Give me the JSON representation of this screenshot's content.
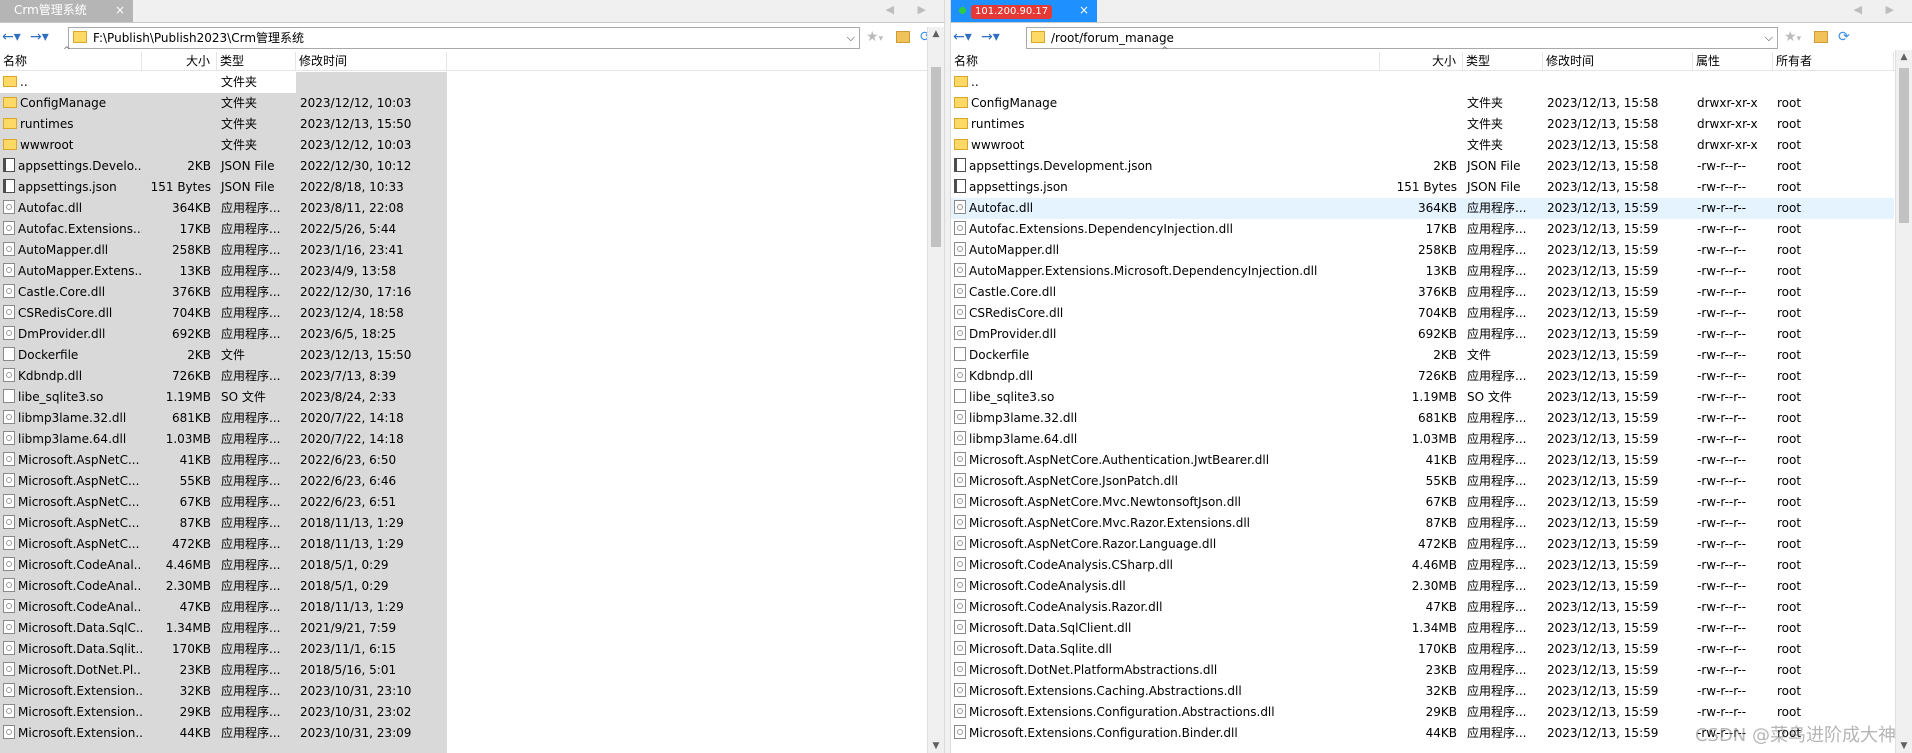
{
  "left": {
    "tab_title": "Crm管理系统",
    "tab_close": "×",
    "tab_arrows": "◀ ▶",
    "nav_back": "←▾",
    "nav_forward": "→▾",
    "address": "F:\\Publish\\Publish2023\\Crm管理系统",
    "address_drop": "⌵",
    "headers": {
      "name": "名称",
      "size": "大小",
      "type": "类型",
      "modified": "修改时间"
    },
    "sort_caret": "^",
    "rows": [
      {
        "icon": "folder",
        "name": "..",
        "size": "",
        "type": "文件夹",
        "modified": ""
      },
      {
        "icon": "folder",
        "name": "ConfigManage",
        "size": "",
        "type": "文件夹",
        "modified": "2023/12/12, 10:03"
      },
      {
        "icon": "folder",
        "name": "runtimes",
        "size": "",
        "type": "文件夹",
        "modified": "2023/12/13, 15:50"
      },
      {
        "icon": "folder",
        "name": "wwwroot",
        "size": "",
        "type": "文件夹",
        "modified": "2023/12/12, 10:03"
      },
      {
        "icon": "json",
        "name": "appsettings.Develo...",
        "size": "2KB",
        "type": "JSON File",
        "modified": "2022/12/30, 10:12"
      },
      {
        "icon": "json",
        "name": "appsettings.json",
        "size": "151 Bytes",
        "type": "JSON File",
        "modified": "2022/8/18, 10:33"
      },
      {
        "icon": "dll",
        "name": "Autofac.dll",
        "size": "364KB",
        "type": "应用程序...",
        "modified": "2023/8/11, 22:08"
      },
      {
        "icon": "dll",
        "name": "Autofac.Extensions....",
        "size": "17KB",
        "type": "应用程序...",
        "modified": "2022/5/26, 5:44"
      },
      {
        "icon": "dll",
        "name": "AutoMapper.dll",
        "size": "258KB",
        "type": "应用程序...",
        "modified": "2023/1/16, 23:41"
      },
      {
        "icon": "dll",
        "name": "AutoMapper.Extens...",
        "size": "13KB",
        "type": "应用程序...",
        "modified": "2023/4/9, 13:58"
      },
      {
        "icon": "dll",
        "name": "Castle.Core.dll",
        "size": "376KB",
        "type": "应用程序...",
        "modified": "2022/12/30, 17:16"
      },
      {
        "icon": "dll",
        "name": "CSRedisCore.dll",
        "size": "704KB",
        "type": "应用程序...",
        "modified": "2023/12/4, 18:58"
      },
      {
        "icon": "dll",
        "name": "DmProvider.dll",
        "size": "692KB",
        "type": "应用程序...",
        "modified": "2023/6/5, 18:25"
      },
      {
        "icon": "file",
        "name": "Dockerfile",
        "size": "2KB",
        "type": "文件",
        "modified": "2023/12/13, 15:50"
      },
      {
        "icon": "dll",
        "name": "Kdbndp.dll",
        "size": "726KB",
        "type": "应用程序...",
        "modified": "2023/7/13, 8:39"
      },
      {
        "icon": "file",
        "name": "libe_sqlite3.so",
        "size": "1.19MB",
        "type": "SO 文件",
        "modified": "2023/8/24, 2:33"
      },
      {
        "icon": "dll",
        "name": "libmp3lame.32.dll",
        "size": "681KB",
        "type": "应用程序...",
        "modified": "2020/7/22, 14:18"
      },
      {
        "icon": "dll",
        "name": "libmp3lame.64.dll",
        "size": "1.03MB",
        "type": "应用程序...",
        "modified": "2020/7/22, 14:18"
      },
      {
        "icon": "dll",
        "name": "Microsoft.AspNetC...",
        "size": "41KB",
        "type": "应用程序...",
        "modified": "2022/6/23, 6:50"
      },
      {
        "icon": "dll",
        "name": "Microsoft.AspNetC...",
        "size": "55KB",
        "type": "应用程序...",
        "modified": "2022/6/23, 6:46"
      },
      {
        "icon": "dll",
        "name": "Microsoft.AspNetC...",
        "size": "67KB",
        "type": "应用程序...",
        "modified": "2022/6/23, 6:51"
      },
      {
        "icon": "dll",
        "name": "Microsoft.AspNetC...",
        "size": "87KB",
        "type": "应用程序...",
        "modified": "2018/11/13, 1:29"
      },
      {
        "icon": "dll",
        "name": "Microsoft.AspNetC...",
        "size": "472KB",
        "type": "应用程序...",
        "modified": "2018/11/13, 1:29"
      },
      {
        "icon": "dll",
        "name": "Microsoft.CodeAnal...",
        "size": "4.46MB",
        "type": "应用程序...",
        "modified": "2018/5/1, 0:29"
      },
      {
        "icon": "dll",
        "name": "Microsoft.CodeAnal...",
        "size": "2.30MB",
        "type": "应用程序...",
        "modified": "2018/5/1, 0:29"
      },
      {
        "icon": "dll",
        "name": "Microsoft.CodeAnal...",
        "size": "47KB",
        "type": "应用程序...",
        "modified": "2018/11/13, 1:29"
      },
      {
        "icon": "dll",
        "name": "Microsoft.Data.SqlC...",
        "size": "1.34MB",
        "type": "应用程序...",
        "modified": "2021/9/21, 7:59"
      },
      {
        "icon": "dll",
        "name": "Microsoft.Data.Sqlit...",
        "size": "170KB",
        "type": "应用程序...",
        "modified": "2023/11/1, 6:15"
      },
      {
        "icon": "dll",
        "name": "Microsoft.DotNet.Pl...",
        "size": "23KB",
        "type": "应用程序...",
        "modified": "2018/5/16, 5:01"
      },
      {
        "icon": "dll",
        "name": "Microsoft.Extension...",
        "size": "32KB",
        "type": "应用程序...",
        "modified": "2023/10/31, 23:10"
      },
      {
        "icon": "dll",
        "name": "Microsoft.Extension...",
        "size": "29KB",
        "type": "应用程序...",
        "modified": "2023/10/31, 23:02"
      },
      {
        "icon": "dll",
        "name": "Microsoft.Extension...",
        "size": "44KB",
        "type": "应用程序...",
        "modified": "2023/10/31, 23:09"
      }
    ]
  },
  "right": {
    "tab_host": "101.200.90.17",
    "tab_close": "×",
    "tab_arrows": "◀ ▶",
    "nav_back": "←▾",
    "nav_forward": "→▾",
    "address": "/root/forum_manage",
    "address_drop": "⌵",
    "headers": {
      "name": "名称",
      "size": "大小",
      "type": "类型",
      "modified": "修改时间",
      "attr": "属性",
      "owner": "所有者"
    },
    "sort_caret": "^",
    "rows": [
      {
        "icon": "folder",
        "name": "..",
        "size": "",
        "type": "",
        "modified": "",
        "attr": "",
        "owner": ""
      },
      {
        "icon": "folder",
        "name": "ConfigManage",
        "size": "",
        "type": "文件夹",
        "modified": "2023/12/13, 15:58",
        "attr": "drwxr-xr-x",
        "owner": "root"
      },
      {
        "icon": "folder",
        "name": "runtimes",
        "size": "",
        "type": "文件夹",
        "modified": "2023/12/13, 15:58",
        "attr": "drwxr-xr-x",
        "owner": "root"
      },
      {
        "icon": "folder",
        "name": "wwwroot",
        "size": "",
        "type": "文件夹",
        "modified": "2023/12/13, 15:58",
        "attr": "drwxr-xr-x",
        "owner": "root"
      },
      {
        "icon": "json",
        "name": "appsettings.Development.json",
        "size": "2KB",
        "type": "JSON File",
        "modified": "2023/12/13, 15:58",
        "attr": "-rw-r--r--",
        "owner": "root"
      },
      {
        "icon": "json",
        "name": "appsettings.json",
        "size": "151 Bytes",
        "type": "JSON File",
        "modified": "2023/12/13, 15:58",
        "attr": "-rw-r--r--",
        "owner": "root"
      },
      {
        "icon": "dll",
        "name": "Autofac.dll",
        "size": "364KB",
        "type": "应用程序...",
        "modified": "2023/12/13, 15:59",
        "attr": "-rw-r--r--",
        "owner": "root",
        "selected": true
      },
      {
        "icon": "dll",
        "name": "Autofac.Extensions.DependencyInjection.dll",
        "size": "17KB",
        "type": "应用程序...",
        "modified": "2023/12/13, 15:59",
        "attr": "-rw-r--r--",
        "owner": "root"
      },
      {
        "icon": "dll",
        "name": "AutoMapper.dll",
        "size": "258KB",
        "type": "应用程序...",
        "modified": "2023/12/13, 15:59",
        "attr": "-rw-r--r--",
        "owner": "root"
      },
      {
        "icon": "dll",
        "name": "AutoMapper.Extensions.Microsoft.DependencyInjection.dll",
        "size": "13KB",
        "type": "应用程序...",
        "modified": "2023/12/13, 15:59",
        "attr": "-rw-r--r--",
        "owner": "root"
      },
      {
        "icon": "dll",
        "name": "Castle.Core.dll",
        "size": "376KB",
        "type": "应用程序...",
        "modified": "2023/12/13, 15:59",
        "attr": "-rw-r--r--",
        "owner": "root"
      },
      {
        "icon": "dll",
        "name": "CSRedisCore.dll",
        "size": "704KB",
        "type": "应用程序...",
        "modified": "2023/12/13, 15:59",
        "attr": "-rw-r--r--",
        "owner": "root"
      },
      {
        "icon": "dll",
        "name": "DmProvider.dll",
        "size": "692KB",
        "type": "应用程序...",
        "modified": "2023/12/13, 15:59",
        "attr": "-rw-r--r--",
        "owner": "root"
      },
      {
        "icon": "file",
        "name": "Dockerfile",
        "size": "2KB",
        "type": "文件",
        "modified": "2023/12/13, 15:59",
        "attr": "-rw-r--r--",
        "owner": "root"
      },
      {
        "icon": "dll",
        "name": "Kdbndp.dll",
        "size": "726KB",
        "type": "应用程序...",
        "modified": "2023/12/13, 15:59",
        "attr": "-rw-r--r--",
        "owner": "root"
      },
      {
        "icon": "file",
        "name": "libe_sqlite3.so",
        "size": "1.19MB",
        "type": "SO 文件",
        "modified": "2023/12/13, 15:59",
        "attr": "-rw-r--r--",
        "owner": "root"
      },
      {
        "icon": "dll",
        "name": "libmp3lame.32.dll",
        "size": "681KB",
        "type": "应用程序...",
        "modified": "2023/12/13, 15:59",
        "attr": "-rw-r--r--",
        "owner": "root"
      },
      {
        "icon": "dll",
        "name": "libmp3lame.64.dll",
        "size": "1.03MB",
        "type": "应用程序...",
        "modified": "2023/12/13, 15:59",
        "attr": "-rw-r--r--",
        "owner": "root"
      },
      {
        "icon": "dll",
        "name": "Microsoft.AspNetCore.Authentication.JwtBearer.dll",
        "size": "41KB",
        "type": "应用程序...",
        "modified": "2023/12/13, 15:59",
        "attr": "-rw-r--r--",
        "owner": "root"
      },
      {
        "icon": "dll",
        "name": "Microsoft.AspNetCore.JsonPatch.dll",
        "size": "55KB",
        "type": "应用程序...",
        "modified": "2023/12/13, 15:59",
        "attr": "-rw-r--r--",
        "owner": "root"
      },
      {
        "icon": "dll",
        "name": "Microsoft.AspNetCore.Mvc.NewtonsoftJson.dll",
        "size": "67KB",
        "type": "应用程序...",
        "modified": "2023/12/13, 15:59",
        "attr": "-rw-r--r--",
        "owner": "root"
      },
      {
        "icon": "dll",
        "name": "Microsoft.AspNetCore.Mvc.Razor.Extensions.dll",
        "size": "87KB",
        "type": "应用程序...",
        "modified": "2023/12/13, 15:59",
        "attr": "-rw-r--r--",
        "owner": "root"
      },
      {
        "icon": "dll",
        "name": "Microsoft.AspNetCore.Razor.Language.dll",
        "size": "472KB",
        "type": "应用程序...",
        "modified": "2023/12/13, 15:59",
        "attr": "-rw-r--r--",
        "owner": "root"
      },
      {
        "icon": "dll",
        "name": "Microsoft.CodeAnalysis.CSharp.dll",
        "size": "4.46MB",
        "type": "应用程序...",
        "modified": "2023/12/13, 15:59",
        "attr": "-rw-r--r--",
        "owner": "root"
      },
      {
        "icon": "dll",
        "name": "Microsoft.CodeAnalysis.dll",
        "size": "2.30MB",
        "type": "应用程序...",
        "modified": "2023/12/13, 15:59",
        "attr": "-rw-r--r--",
        "owner": "root"
      },
      {
        "icon": "dll",
        "name": "Microsoft.CodeAnalysis.Razor.dll",
        "size": "47KB",
        "type": "应用程序...",
        "modified": "2023/12/13, 15:59",
        "attr": "-rw-r--r--",
        "owner": "root"
      },
      {
        "icon": "dll",
        "name": "Microsoft.Data.SqlClient.dll",
        "size": "1.34MB",
        "type": "应用程序...",
        "modified": "2023/12/13, 15:59",
        "attr": "-rw-r--r--",
        "owner": "root"
      },
      {
        "icon": "dll",
        "name": "Microsoft.Data.Sqlite.dll",
        "size": "170KB",
        "type": "应用程序...",
        "modified": "2023/12/13, 15:59",
        "attr": "-rw-r--r--",
        "owner": "root"
      },
      {
        "icon": "dll",
        "name": "Microsoft.DotNet.PlatformAbstractions.dll",
        "size": "23KB",
        "type": "应用程序...",
        "modified": "2023/12/13, 15:59",
        "attr": "-rw-r--r--",
        "owner": "root"
      },
      {
        "icon": "dll",
        "name": "Microsoft.Extensions.Caching.Abstractions.dll",
        "size": "32KB",
        "type": "应用程序...",
        "modified": "2023/12/13, 15:59",
        "attr": "-rw-r--r--",
        "owner": "root"
      },
      {
        "icon": "dll",
        "name": "Microsoft.Extensions.Configuration.Abstractions.dll",
        "size": "29KB",
        "type": "应用程序...",
        "modified": "2023/12/13, 15:59",
        "attr": "-rw-r--r--",
        "owner": "root"
      },
      {
        "icon": "dll",
        "name": "Microsoft.Extensions.Configuration.Binder.dll",
        "size": "44KB",
        "type": "应用程序...",
        "modified": "2023/12/13, 15:59",
        "attr": "-rw-r--r--",
        "owner": "root"
      }
    ]
  },
  "watermark": "CSDN @菜鸟进阶成大神",
  "colors": {
    "tab_active": "#1e90ff",
    "host_badge": "#e53935",
    "selected_row": "#e5f3ff",
    "left_band": "#d9d9d9"
  }
}
